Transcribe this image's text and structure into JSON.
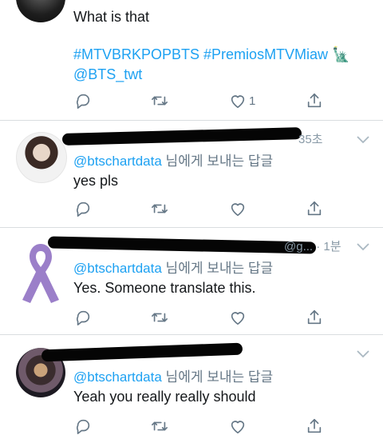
{
  "tweets": [
    {
      "text": "What is that",
      "hashtags": "#MTVBRKPOPBTS #PremiosMTVMiaw",
      "emoji": "🗽",
      "mention": "@BTS_twt",
      "like_count": "1"
    },
    {
      "time": "35초",
      "reply_handle": "@btschartdata",
      "reply_suffix": " 님에게 보내는 답글",
      "text": "yes pls"
    },
    {
      "meta_tail": "@g... · 1분",
      "reply_handle": "@btschartdata",
      "reply_suffix": " 님에게 보내는 답글",
      "text": "Yes. Someone translate this."
    },
    {
      "reply_handle": "@btschartdata",
      "reply_suffix": " 님에게 보내는 답글",
      "text": "Yeah you really really should"
    }
  ],
  "icons": [
    "reply-icon",
    "retweet-icon",
    "like-icon",
    "share-icon",
    "chevron-down-icon",
    "purple-ribbon-avatar"
  ],
  "colors": {
    "link": "#1da1f2",
    "muted": "#657786",
    "separator": "#d9dde0",
    "ribbon": "#9b7fc9"
  }
}
